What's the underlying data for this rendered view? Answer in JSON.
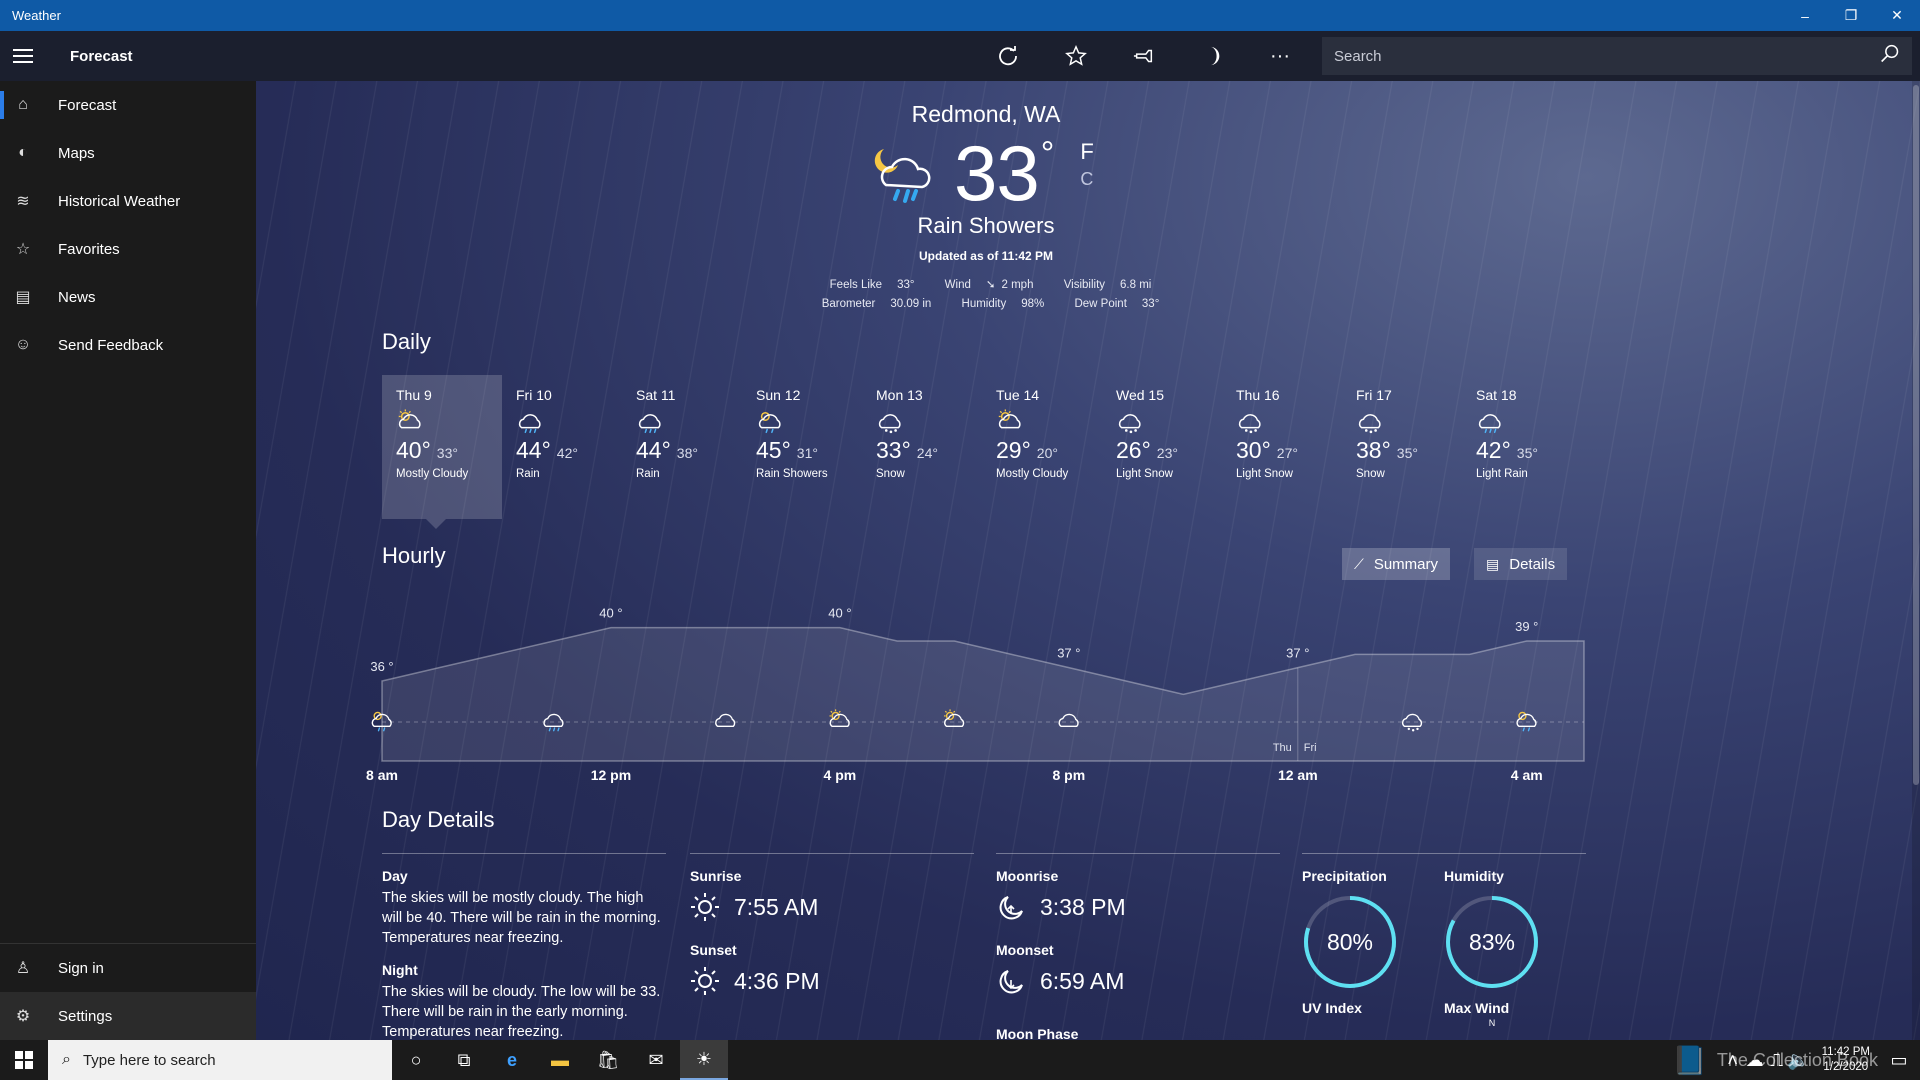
{
  "window": {
    "title": "Weather",
    "minimize": "–",
    "restore": "❐",
    "close": "✕"
  },
  "commandbar": {
    "title": "Forecast",
    "search_placeholder": "Search",
    "more": "···"
  },
  "sidebar": {
    "items": [
      {
        "label": "Forecast",
        "icon": "⌂"
      },
      {
        "label": "Maps",
        "icon": "◐"
      },
      {
        "label": "Historical Weather",
        "icon": "≋"
      },
      {
        "label": "Favorites",
        "icon": "☆"
      },
      {
        "label": "News",
        "icon": "▤"
      },
      {
        "label": "Send Feedback",
        "icon": "☺"
      }
    ],
    "bottom": [
      {
        "label": "Sign in",
        "icon": "♙"
      },
      {
        "label": "Settings",
        "icon": "⚙"
      }
    ]
  },
  "current": {
    "location": "Redmond, WA",
    "temp": "33",
    "deg": "°",
    "unit_f": "F",
    "unit_c": "C",
    "condition": "Rain Showers",
    "updated": "Updated as of 11:42 PM",
    "feels_like_label": "Feels Like",
    "feels_like": "33°",
    "wind_label": "Wind",
    "wind": "2 mph",
    "visibility_label": "Visibility",
    "visibility": "6.8 mi",
    "barometer_label": "Barometer",
    "barometer": "30.09 in",
    "humidity_label": "Humidity",
    "humidity": "98%",
    "dewpoint_label": "Dew Point",
    "dewpoint": "33°"
  },
  "daily": {
    "title": "Daily",
    "days": [
      {
        "name": "Thu 9",
        "hi": "40°",
        "lo": "33°",
        "cond": "Mostly Cloudy",
        "icon": "partly"
      },
      {
        "name": "Fri 10",
        "hi": "44°",
        "lo": "42°",
        "cond": "Rain",
        "icon": "rain"
      },
      {
        "name": "Sat 11",
        "hi": "44°",
        "lo": "38°",
        "cond": "Rain",
        "icon": "rain"
      },
      {
        "name": "Sun 12",
        "hi": "45°",
        "lo": "31°",
        "cond": "Rain Showers",
        "icon": "showers"
      },
      {
        "name": "Mon 13",
        "hi": "33°",
        "lo": "24°",
        "cond": "Snow",
        "icon": "snow"
      },
      {
        "name": "Tue 14",
        "hi": "29°",
        "lo": "20°",
        "cond": "Mostly Cloudy",
        "icon": "partly"
      },
      {
        "name": "Wed 15",
        "hi": "26°",
        "lo": "23°",
        "cond": "Light Snow",
        "icon": "snow"
      },
      {
        "name": "Thu 16",
        "hi": "30°",
        "lo": "27°",
        "cond": "Light Snow",
        "icon": "snow"
      },
      {
        "name": "Fri 17",
        "hi": "38°",
        "lo": "35°",
        "cond": "Snow",
        "icon": "snow"
      },
      {
        "name": "Sat 18",
        "hi": "42°",
        "lo": "35°",
        "cond": "Light Rain",
        "icon": "rain"
      }
    ]
  },
  "hourly": {
    "title": "Hourly",
    "summary_label": "Summary",
    "details_label": "Details",
    "day_left": "Thu",
    "day_right": "Fri"
  },
  "chart_data": {
    "type": "area",
    "x": [
      "8 am",
      "9 am",
      "10 am",
      "11 am",
      "12 pm",
      "1 pm",
      "2 pm",
      "3 pm",
      "4 pm",
      "5 pm",
      "6 pm",
      "7 pm",
      "8 pm",
      "9 pm",
      "10 pm",
      "11 pm",
      "12 am",
      "1 am",
      "2 am",
      "3 am",
      "4 am",
      "5 am"
    ],
    "values": [
      36,
      37,
      38,
      39,
      40,
      40,
      40,
      40,
      40,
      39,
      39,
      38,
      37,
      36,
      35,
      36,
      37,
      38,
      38,
      38,
      39,
      39
    ],
    "tick_labels": [
      "8 am",
      "12 pm",
      "4 pm",
      "8 pm",
      "12 am",
      "4 am"
    ],
    "tick_hours": [
      0,
      4,
      8,
      12,
      16,
      20
    ],
    "temp_labels": [
      {
        "hour": 0,
        "text": "36 °"
      },
      {
        "hour": 4,
        "text": "40 °"
      },
      {
        "hour": 8,
        "text": "40 °"
      },
      {
        "hour": 12,
        "text": "37 °"
      },
      {
        "hour": 16,
        "text": "37 °"
      },
      {
        "hour": 20,
        "text": "39 °"
      }
    ],
    "icons": [
      {
        "hour": 0,
        "icon": "showers"
      },
      {
        "hour": 3,
        "icon": "rain"
      },
      {
        "hour": 6,
        "icon": "cloud"
      },
      {
        "hour": 8,
        "icon": "partly"
      },
      {
        "hour": 10,
        "icon": "partly"
      },
      {
        "hour": 12,
        "icon": "cloud"
      },
      {
        "hour": 18,
        "icon": "snow"
      },
      {
        "hour": 20,
        "icon": "showers"
      }
    ],
    "ylim": [
      30,
      42
    ]
  },
  "day_details": {
    "title": "Day Details",
    "day_label": "Day",
    "day_text": "The skies will be mostly cloudy. The high will be 40. There will be rain in the morning. Temperatures near freezing.",
    "night_label": "Night",
    "night_text": "The skies will be cloudy. The low will be 33. There will be rain in the early morning. Temperatures near freezing.",
    "sunrise_label": "Sunrise",
    "sunrise": "7:55 AM",
    "sunset_label": "Sunset",
    "sunset": "4:36 PM",
    "moonrise_label": "Moonrise",
    "moonrise": "3:38 PM",
    "moonset_label": "Moonset",
    "moonset": "6:59 AM",
    "moonphase_label": "Moon Phase",
    "precip_label": "Precipitation",
    "precip": "80%",
    "precip_pct": 80,
    "humidity_label": "Humidity",
    "humidity": "83%",
    "humidity_pct": 83,
    "uv_label": "UV Index",
    "wind_label": "Max Wind",
    "wind_dir": "N"
  },
  "taskbar": {
    "search_placeholder": "Type here to search",
    "time": "11:42 PM",
    "date": "1/2/2020",
    "watermark": "The Collection Book"
  },
  "colors": {
    "accent": "#2b7de9",
    "ring": "#5ee0f2",
    "titlebar": "#0f5aa6"
  }
}
